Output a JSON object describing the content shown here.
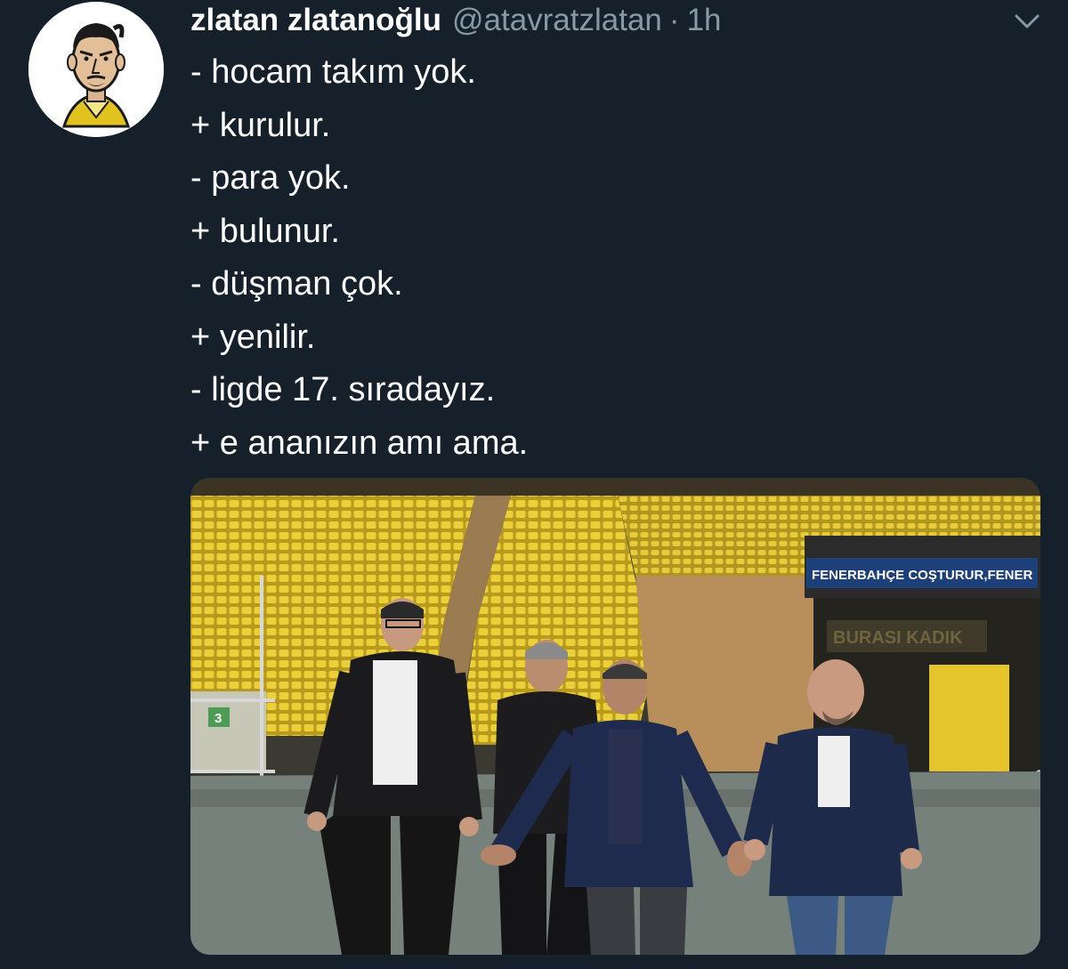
{
  "tweet": {
    "display_name": "zlatan zlatanoğlu",
    "handle": "@atavratzlatan",
    "separator": "·",
    "time": "1h",
    "lines": [
      "- hocam takım yok.",
      "+ kurulur.",
      "- para yok.",
      "+ bulunur.",
      "- düşman çok.",
      "+ yenilir.",
      "- ligde 17. sıradayız.",
      "+ e ananızın amı ama."
    ],
    "media": {
      "banner_text": "FENERBAHÇE COŞTURUR,FENER",
      "tunnel_text": "BURASI KADIK",
      "gate_number": "3"
    }
  },
  "icons": {
    "more": "chevron-down-icon",
    "avatar": "avatar-illustration"
  },
  "colors": {
    "background": "#15202b",
    "text": "#ffffff",
    "secondary": "#8899a6",
    "seats": "#e8c832"
  }
}
